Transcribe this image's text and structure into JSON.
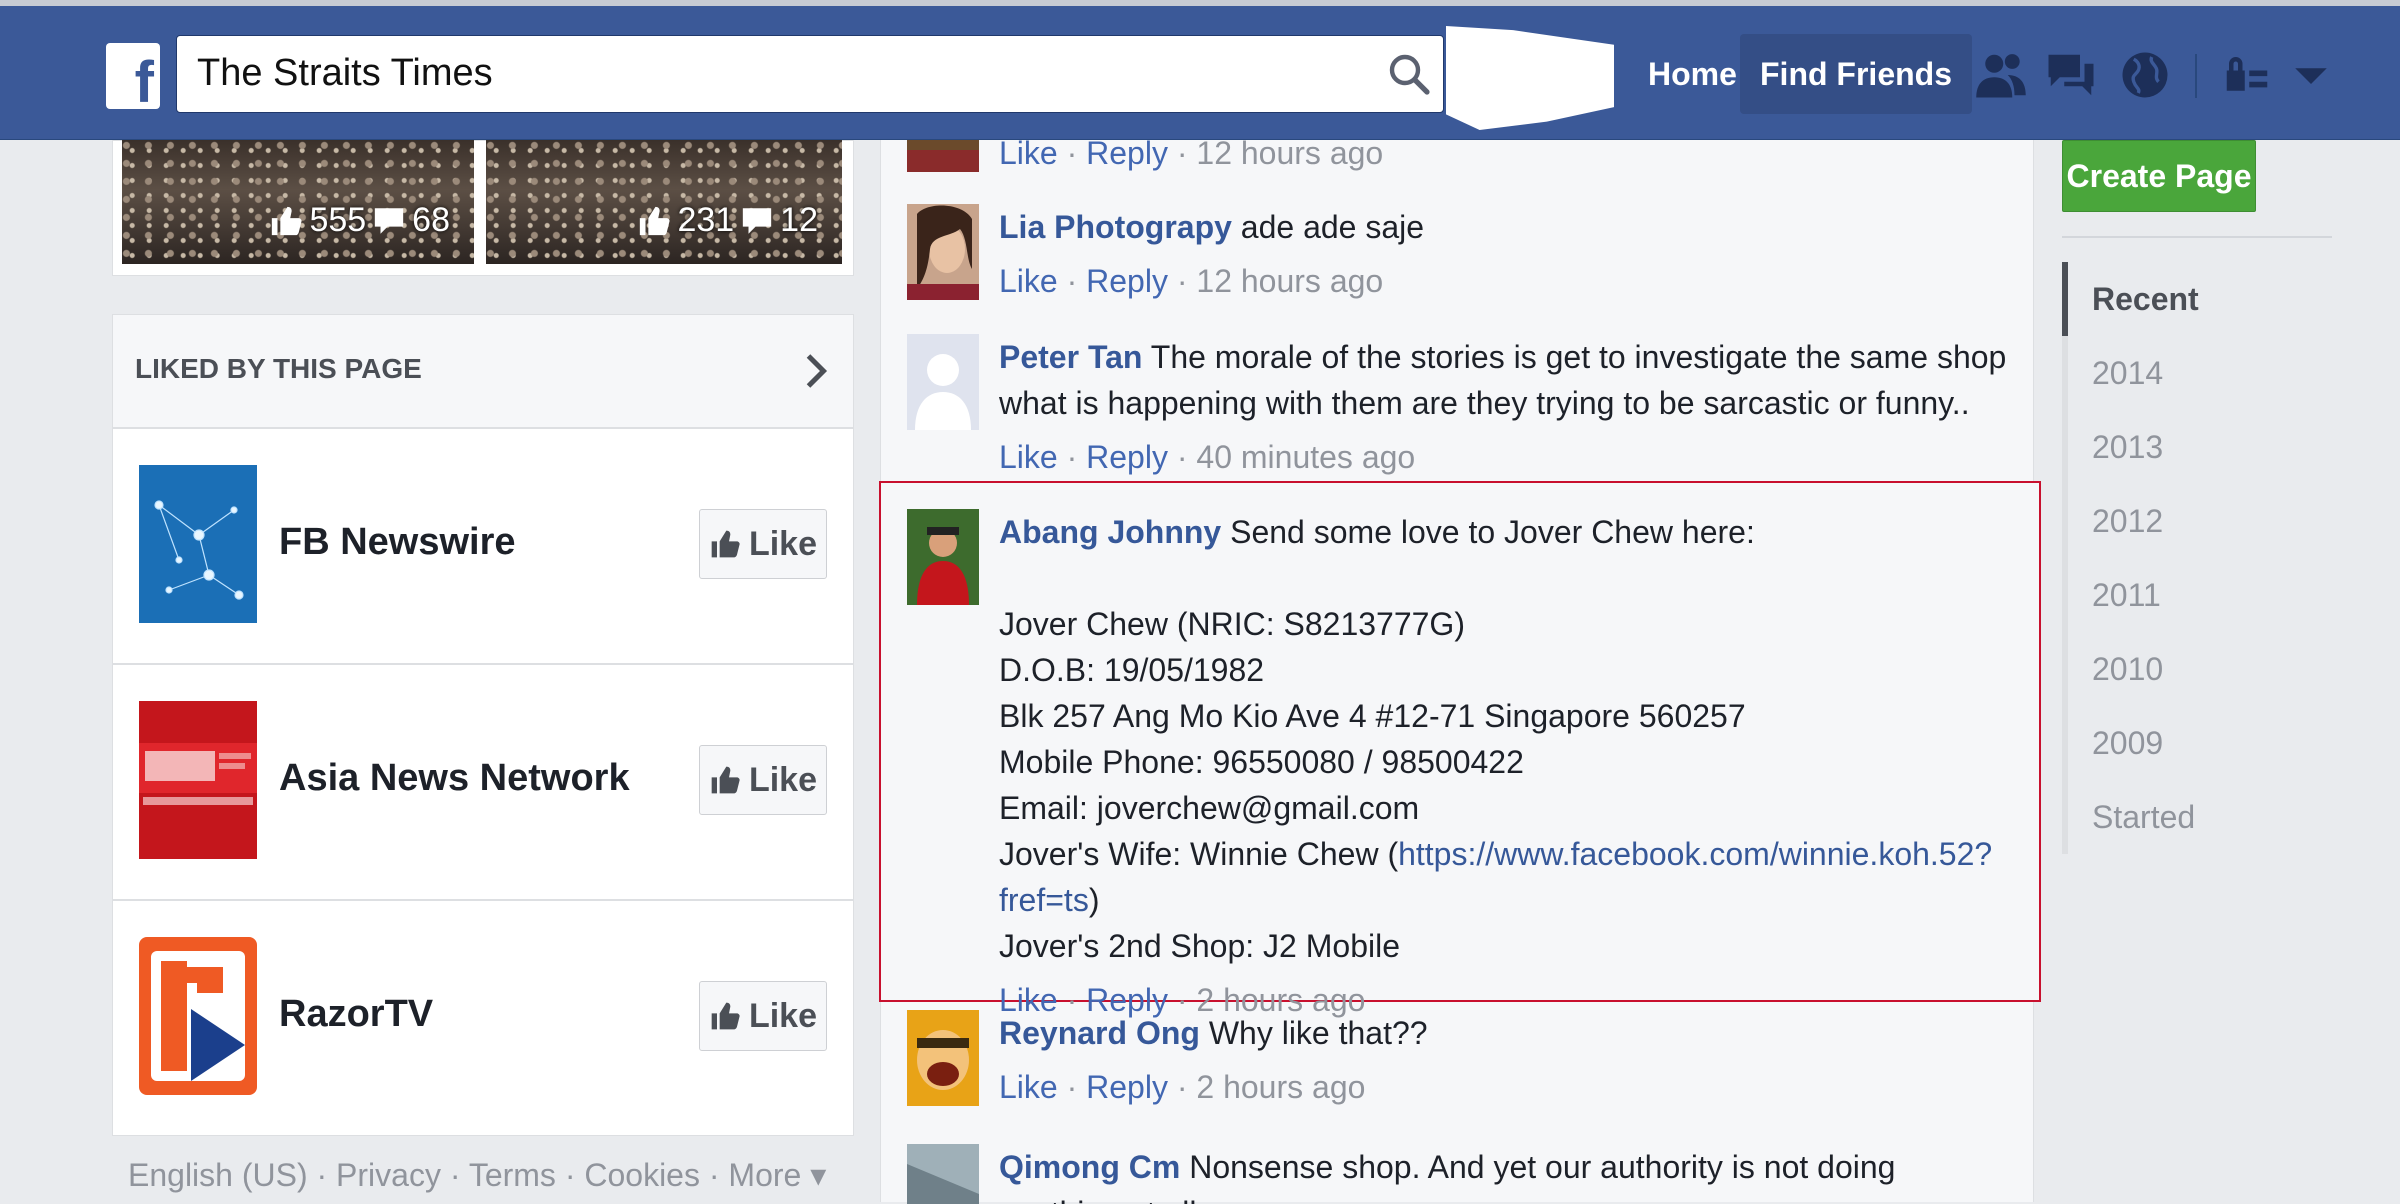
{
  "header": {
    "search_value": "The Straits Times",
    "nav": {
      "home": "Home",
      "find_friends": "Find Friends"
    }
  },
  "left": {
    "photos": [
      {
        "likes": "555",
        "comments": "68"
      },
      {
        "likes": "231",
        "comments": "12"
      }
    ],
    "liked_title": "LIKED BY THIS PAGE",
    "pages": [
      {
        "name": "FB Newswire",
        "like_label": "Like"
      },
      {
        "name": "Asia News Network",
        "like_label": "Like"
      },
      {
        "name": "RazorTV",
        "like_label": "Like"
      }
    ],
    "footer": [
      "English (US)",
      "Privacy",
      "Terms",
      "Cookies",
      "More ▾"
    ]
  },
  "comments": [
    {
      "author": "",
      "text": "",
      "time": "12 hours ago"
    },
    {
      "author": "Lia Photograpy",
      "text": " ade ade saje",
      "time": "12 hours ago"
    },
    {
      "author": "Peter Tan",
      "text": " The morale of the stories is get to investigate the same shop what is happening with them are they trying to be sarcastic or funny..",
      "time": "40 minutes ago"
    },
    {
      "author": "Abang Johnny",
      "text": " Send some love to Jover Chew here:",
      "lines": [
        "Jover Chew (NRIC: S8213777G)",
        "D.O.B: 19/05/1982",
        "Blk 257 Ang Mo Kio Ave 4 #12-71 Singapore 560257",
        "Mobile Phone: 96550080 / 98500422",
        "Email: joverchew@gmail.com"
      ],
      "wife_prefix": "Jover's Wife: Winnie Chew (",
      "wife_link": "https://www.facebook.com/winnie.koh.52?fref=ts",
      "wife_suffix": ")",
      "shop_line": "Jover's 2nd Shop: J2 Mobile",
      "time": "2 hours ago"
    },
    {
      "author": "Reynard Ong",
      "text": " Why like that??",
      "time": "2 hours ago"
    },
    {
      "author": "Qimong Cm",
      "text": " Nonsense shop. And yet our authority is not doing anything at all."
    }
  ],
  "actions": {
    "like": "Like",
    "reply": "Reply",
    "sep": " · "
  },
  "right": {
    "create_page": "Create Page",
    "timeline": [
      "Recent",
      "2014",
      "2013",
      "2012",
      "2011",
      "2010",
      "2009",
      "Started"
    ]
  }
}
